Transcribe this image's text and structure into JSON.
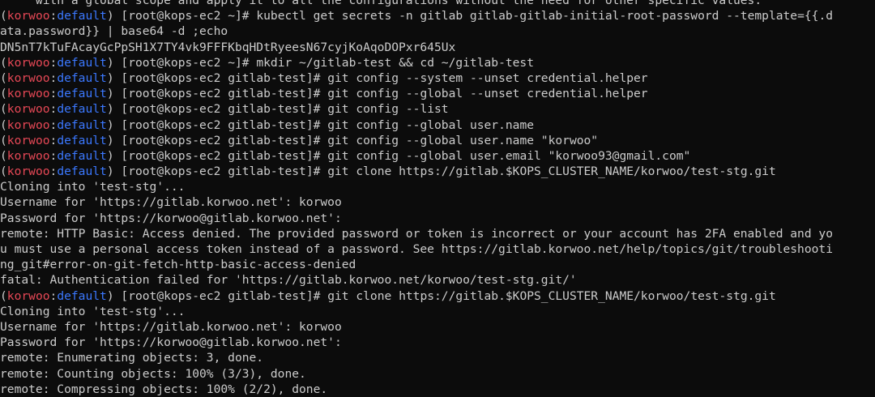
{
  "colors": {
    "background": "#0c0c0c",
    "foreground": "#cccccc",
    "context_user": "#e74856",
    "context_namespace": "#3b78ff"
  },
  "context": {
    "user": "korwoo",
    "namespace": "default"
  },
  "lines": [
    {
      "kind": "output",
      "text": "     with a global scope and apply it to all the configurations without the need for other specific values."
    },
    {
      "kind": "prompt",
      "prompt": "[root@kops-ec2 ~]# ",
      "command": "kubectl get secrets -n gitlab gitlab-gitlab-initial-root-password --template={{.d"
    },
    {
      "kind": "output",
      "text": "ata.password}} | base64 -d ;echo"
    },
    {
      "kind": "output",
      "text": "DN5nT7kTuFAcayGcPpSH1X7TY4vk9FFFKbqHDtRyeesN67cyjKoAqoDOPxr645Ux"
    },
    {
      "kind": "prompt",
      "prompt": "[root@kops-ec2 ~]# ",
      "command": "mkdir ~/gitlab-test && cd ~/gitlab-test"
    },
    {
      "kind": "prompt",
      "prompt": "[root@kops-ec2 gitlab-test]# ",
      "command": "git config --system --unset credential.helper"
    },
    {
      "kind": "prompt",
      "prompt": "[root@kops-ec2 gitlab-test]# ",
      "command": "git config --global --unset credential.helper"
    },
    {
      "kind": "prompt",
      "prompt": "[root@kops-ec2 gitlab-test]# ",
      "command": "git config --list"
    },
    {
      "kind": "prompt",
      "prompt": "[root@kops-ec2 gitlab-test]# ",
      "command": "git config --global user.name"
    },
    {
      "kind": "prompt",
      "prompt": "[root@kops-ec2 gitlab-test]# ",
      "command": "git config --global user.name \"korwoo\""
    },
    {
      "kind": "prompt",
      "prompt": "[root@kops-ec2 gitlab-test]# ",
      "command": "git config --global user.email \"korwoo93@gmail.com\""
    },
    {
      "kind": "prompt",
      "prompt": "[root@kops-ec2 gitlab-test]# ",
      "command": "git clone https://gitlab.$KOPS_CLUSTER_NAME/korwoo/test-stg.git"
    },
    {
      "kind": "output",
      "text": "Cloning into 'test-stg'..."
    },
    {
      "kind": "output",
      "text": "Username for 'https://gitlab.korwoo.net': korwoo"
    },
    {
      "kind": "output",
      "text": "Password for 'https://korwoo@gitlab.korwoo.net':"
    },
    {
      "kind": "output",
      "text": "remote: HTTP Basic: Access denied. The provided password or token is incorrect or your account has 2FA enabled and yo"
    },
    {
      "kind": "output",
      "text": "u must use a personal access token instead of a password. See https://gitlab.korwoo.net/help/topics/git/troubleshooti"
    },
    {
      "kind": "output",
      "text": "ng_git#error-on-git-fetch-http-basic-access-denied"
    },
    {
      "kind": "output",
      "text": "fatal: Authentication failed for 'https://gitlab.korwoo.net/korwoo/test-stg.git/'"
    },
    {
      "kind": "prompt",
      "prompt": "[root@kops-ec2 gitlab-test]# ",
      "command": "git clone https://gitlab.$KOPS_CLUSTER_NAME/korwoo/test-stg.git"
    },
    {
      "kind": "output",
      "text": "Cloning into 'test-stg'..."
    },
    {
      "kind": "output",
      "text": "Username for 'https://gitlab.korwoo.net': korwoo"
    },
    {
      "kind": "output",
      "text": "Password for 'https://korwoo@gitlab.korwoo.net':"
    },
    {
      "kind": "output",
      "text": "remote: Enumerating objects: 3, done."
    },
    {
      "kind": "output",
      "text": "remote: Counting objects: 100% (3/3), done."
    },
    {
      "kind": "output",
      "text": "remote: Compressing objects: 100% (2/2), done."
    }
  ]
}
